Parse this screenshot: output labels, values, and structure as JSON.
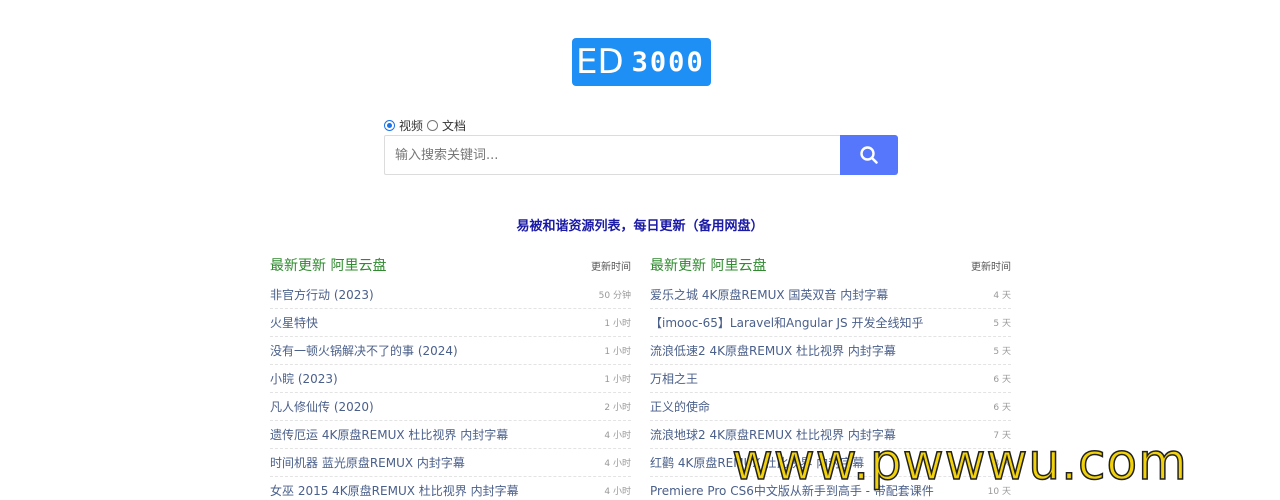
{
  "logo": {
    "part1": "ED",
    "part2": "3000",
    "color": "#1e8ff5"
  },
  "search_type": {
    "options": [
      {
        "label": "视频",
        "checked": true
      },
      {
        "label": "文档",
        "checked": false
      }
    ]
  },
  "search": {
    "placeholder": "输入搜索关键词...",
    "button_icon": "search-icon",
    "button_color": "#5677fc"
  },
  "notice": "易被和谐资源列表，每日更新（备用网盘）",
  "left_column": {
    "title": "最新更新 阿里云盘",
    "subtitle": "更新时间",
    "items": [
      {
        "title": "非官方行动 (2023)",
        "time": "50 分钟"
      },
      {
        "title": "火星特快",
        "time": "1 小时"
      },
      {
        "title": "没有一顿火锅解决不了的事 (2024)",
        "time": "1 小时"
      },
      {
        "title": "小睆 (2023)",
        "time": "1 小时"
      },
      {
        "title": "凡人修仙传 (2020)",
        "time": "2 小时"
      },
      {
        "title": "遗传厄运 4K原盘REMUX 杜比视界 内封字幕",
        "time": "4 小时"
      },
      {
        "title": "时间机器 蓝光原盘REMUX 内封字幕",
        "time": "4 小时"
      },
      {
        "title": "女巫 2015 4K原盘REMUX 杜比视界 内封字幕",
        "time": "4 小时"
      }
    ]
  },
  "right_column": {
    "title": "最新更新 阿里云盘",
    "subtitle": "更新时间",
    "items": [
      {
        "title": "爱乐之城 4K原盘REMUX 国英双音 内封字幕",
        "time": "4 天"
      },
      {
        "title": "【imooc-65】Laravel和Angular JS 开发全线知乎",
        "time": "5 天"
      },
      {
        "title": "流浪低速2 4K原盘REMUX 杜比视界 内封字幕",
        "time": "5 天"
      },
      {
        "title": "万相之王",
        "time": "6 天"
      },
      {
        "title": "正义的使命",
        "time": "6 天"
      },
      {
        "title": "流浪地球2 4K原盘REMUX 杜比视界 内封字幕",
        "time": "7 天"
      },
      {
        "title": "红鹳 4K原盘REMUX 杜比视界 内封字幕",
        "time": "8 天"
      },
      {
        "title": "Premiere Pro CS6中文版从新手到高手 - 带配套课件",
        "time": "10 天"
      }
    ]
  },
  "watermark": "www.pwwwu.com"
}
